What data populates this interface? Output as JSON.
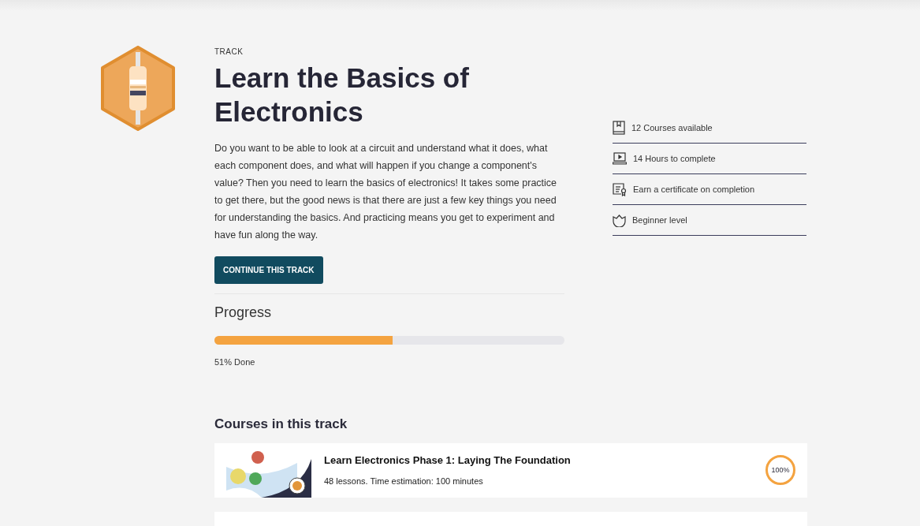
{
  "track": {
    "eyebrow": "TRACK",
    "title": "Learn the Basics of Electronics",
    "description": "Do you want to be able to look at a circuit and understand what it does, what each component does, and what will happen if you change a component's value? Then you need to learn the basics of electronics! It takes some practice to get there, but the good news is that there are just a few key things you need for understanding the basics. And practicing means you get to experiment and have fun along the way.",
    "button": "CONTINUE THIS TRACK"
  },
  "progress": {
    "heading": "Progress",
    "level": 0.51,
    "reading": "51% Done"
  },
  "facts": [
    {
      "kind": "book",
      "text": "12 Courses available"
    },
    {
      "kind": "video",
      "text": "14 Hours to complete"
    },
    {
      "kind": "certificate",
      "text": "Earn a certificate on completion"
    },
    {
      "kind": "level",
      "text": "Beginner level"
    }
  ],
  "courses_heading": "Courses in this track",
  "courses": [
    {
      "title": "Learn Electronics Phase 1: Laying The Foundation",
      "meta": "48 lessons. Time estimation: 100 minutes",
      "completion": "100%",
      "level": 1
    }
  ],
  "more_courses_below": true
}
